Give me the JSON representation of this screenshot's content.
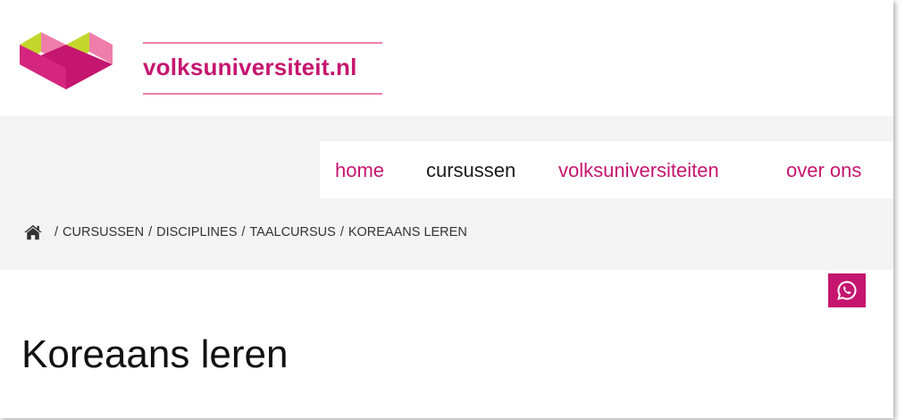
{
  "brand": {
    "name": "volksuniversiteit.nl"
  },
  "nav": {
    "items": [
      {
        "label": "home",
        "active": false
      },
      {
        "label": "cursussen",
        "active": true
      },
      {
        "label": "volksuniversiteiten",
        "active": false
      },
      {
        "label": "over ons",
        "active": false
      }
    ]
  },
  "breadcrumb": {
    "home_icon": "home-icon",
    "separator": "/",
    "items": [
      "CURSUSSEN",
      "DISCIPLINES",
      "TAALCURSUS",
      "KOREAANS LEREN"
    ]
  },
  "share": {
    "icon": "whatsapp-icon"
  },
  "page": {
    "title": "Koreaans leren"
  },
  "colors": {
    "brand_pink": "#c5166f",
    "light_pink": "#ee7ea9",
    "lime": "#c3d72d",
    "band_grey": "#f3f3f3"
  }
}
